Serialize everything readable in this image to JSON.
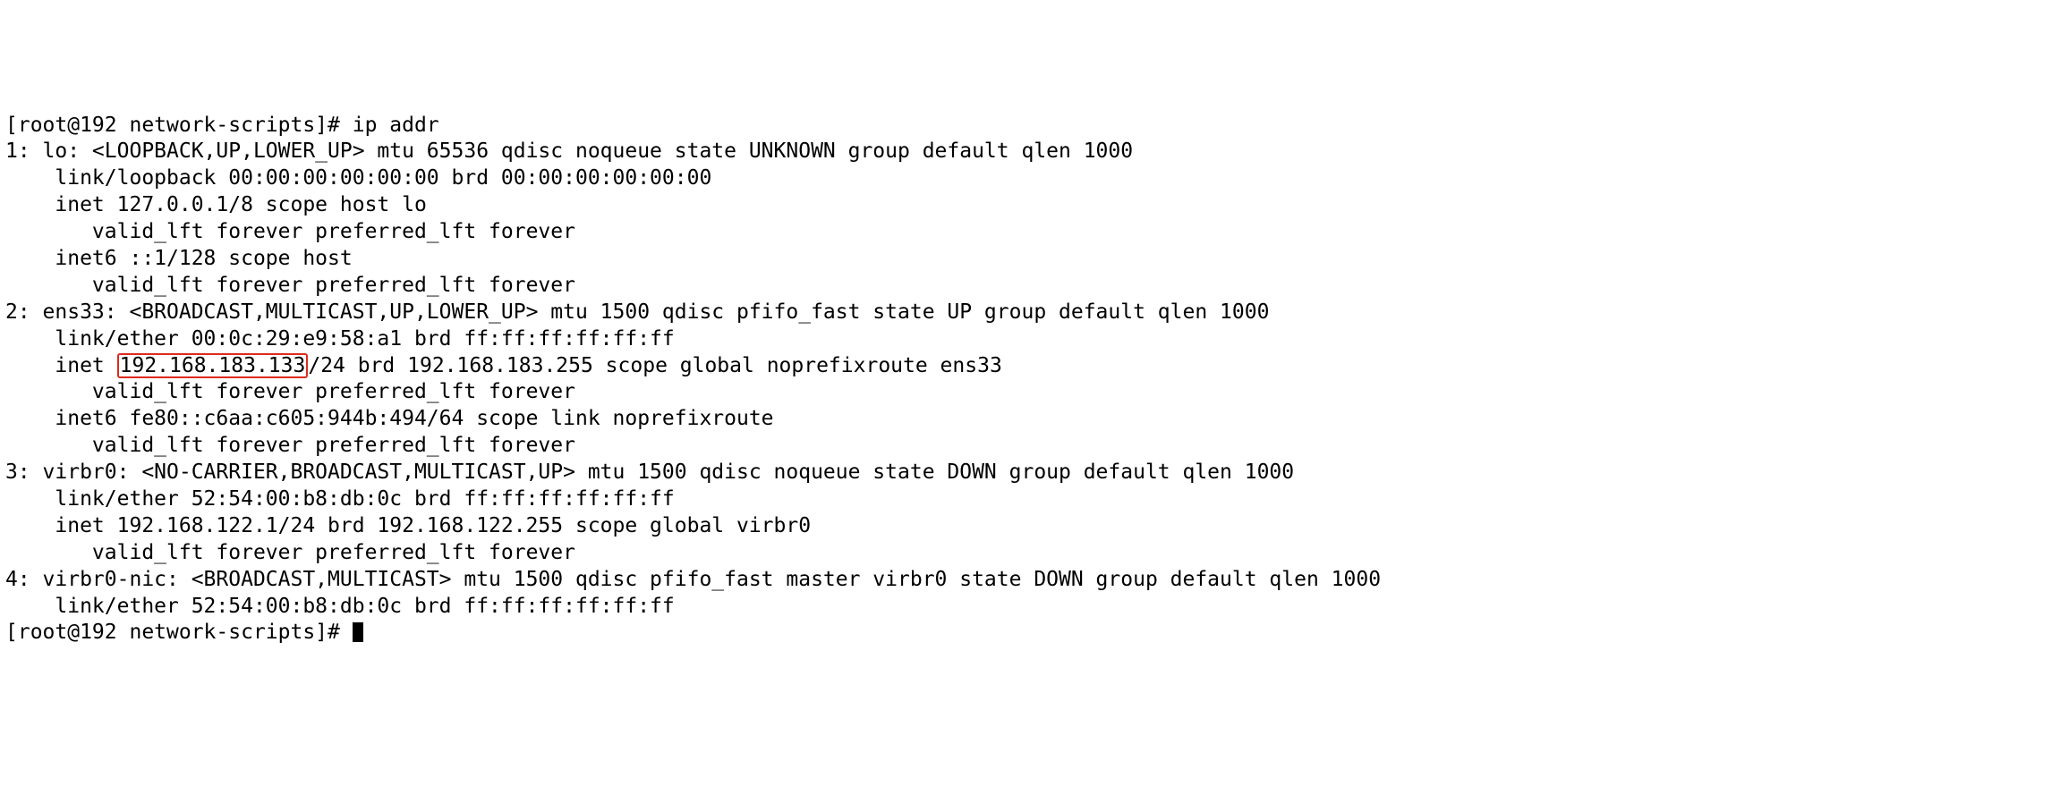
{
  "prompt1": {
    "user_host": "[root@192 network-scripts]# ",
    "command": "ip addr"
  },
  "iface1": {
    "header": "1: lo: <LOOPBACK,UP,LOWER_UP> mtu 65536 qdisc noqueue state UNKNOWN group default qlen 1000",
    "link": "    link/loopback 00:00:00:00:00:00 brd 00:00:00:00:00:00",
    "inet": "    inet 127.0.0.1/8 scope host lo",
    "valid1": "       valid_lft forever preferred_lft forever",
    "inet6": "    inet6 ::1/128 scope host ",
    "valid2": "       valid_lft forever preferred_lft forever"
  },
  "iface2": {
    "header": "2: ens33: <BROADCAST,MULTICAST,UP,LOWER_UP> mtu 1500 qdisc pfifo_fast state UP group default qlen 1000",
    "link": "    link/ether 00:0c:29:e9:58:a1 brd ff:ff:ff:ff:ff:ff",
    "inet_pre": "    inet ",
    "inet_ip": "192.168.183.133",
    "inet_post": "/24 brd 192.168.183.255 scope global noprefixroute ens33",
    "valid1": "       valid_lft forever preferred_lft forever",
    "inet6": "    inet6 fe80::c6aa:c605:944b:494/64 scope link noprefixroute ",
    "valid2": "       valid_lft forever preferred_lft forever"
  },
  "iface3": {
    "header": "3: virbr0: <NO-CARRIER,BROADCAST,MULTICAST,UP> mtu 1500 qdisc noqueue state DOWN group default qlen 1000",
    "link": "    link/ether 52:54:00:b8:db:0c brd ff:ff:ff:ff:ff:ff",
    "inet": "    inet 192.168.122.1/24 brd 192.168.122.255 scope global virbr0",
    "valid1": "       valid_lft forever preferred_lft forever"
  },
  "iface4": {
    "header": "4: virbr0-nic: <BROADCAST,MULTICAST> mtu 1500 qdisc pfifo_fast master virbr0 state DOWN group default qlen 1000",
    "link": "    link/ether 52:54:00:b8:db:0c brd ff:ff:ff:ff:ff:ff"
  },
  "prompt2": {
    "user_host": "[root@192 network-scripts]# "
  },
  "highlight": {
    "color": "#de2a1d",
    "ip": "192.168.183.133"
  }
}
